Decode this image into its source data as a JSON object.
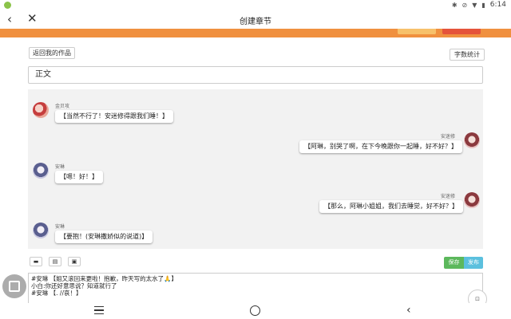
{
  "status_bar": {
    "time": "6:14",
    "icons": [
      "bluetooth-icon",
      "mute-icon",
      "wifi-icon",
      "battery-icon"
    ]
  },
  "titlebar": {
    "title": "创建章节"
  },
  "buttons": {
    "back_to_works": "返回我的作品",
    "word_count": "字数统计",
    "save": "保存",
    "publish": "发布"
  },
  "main_field": {
    "value": "正文"
  },
  "chat": {
    "messages": [
      {
        "side": "left",
        "sender": "金贝攻",
        "text": "【当然不行了！安迷修得跟我们睡！】"
      },
      {
        "side": "right",
        "sender": "安迷修",
        "text": "【阿琳，别哭了啊，在下今晚跟你一起睡，好不好？】"
      },
      {
        "side": "left",
        "sender": "安琳",
        "text": "【嗯！好！】"
      },
      {
        "side": "right",
        "sender": "安迷修",
        "text": "【那么，阿琳小姐姐，我们去睡觉，好不好？】"
      },
      {
        "side": "left",
        "sender": "安琳",
        "text": "【要抱！(安琳撒娇似的说道)】"
      }
    ]
  },
  "editor": {
    "lines": [
      "#安琳 【姐又滚回来更啦！抱歉，昨天写的太水了🙏】",
      "小白:你还好意思说？知道就行了",
      "#安琳 【. //哀！】"
    ]
  },
  "float_right_label": "⊡"
}
